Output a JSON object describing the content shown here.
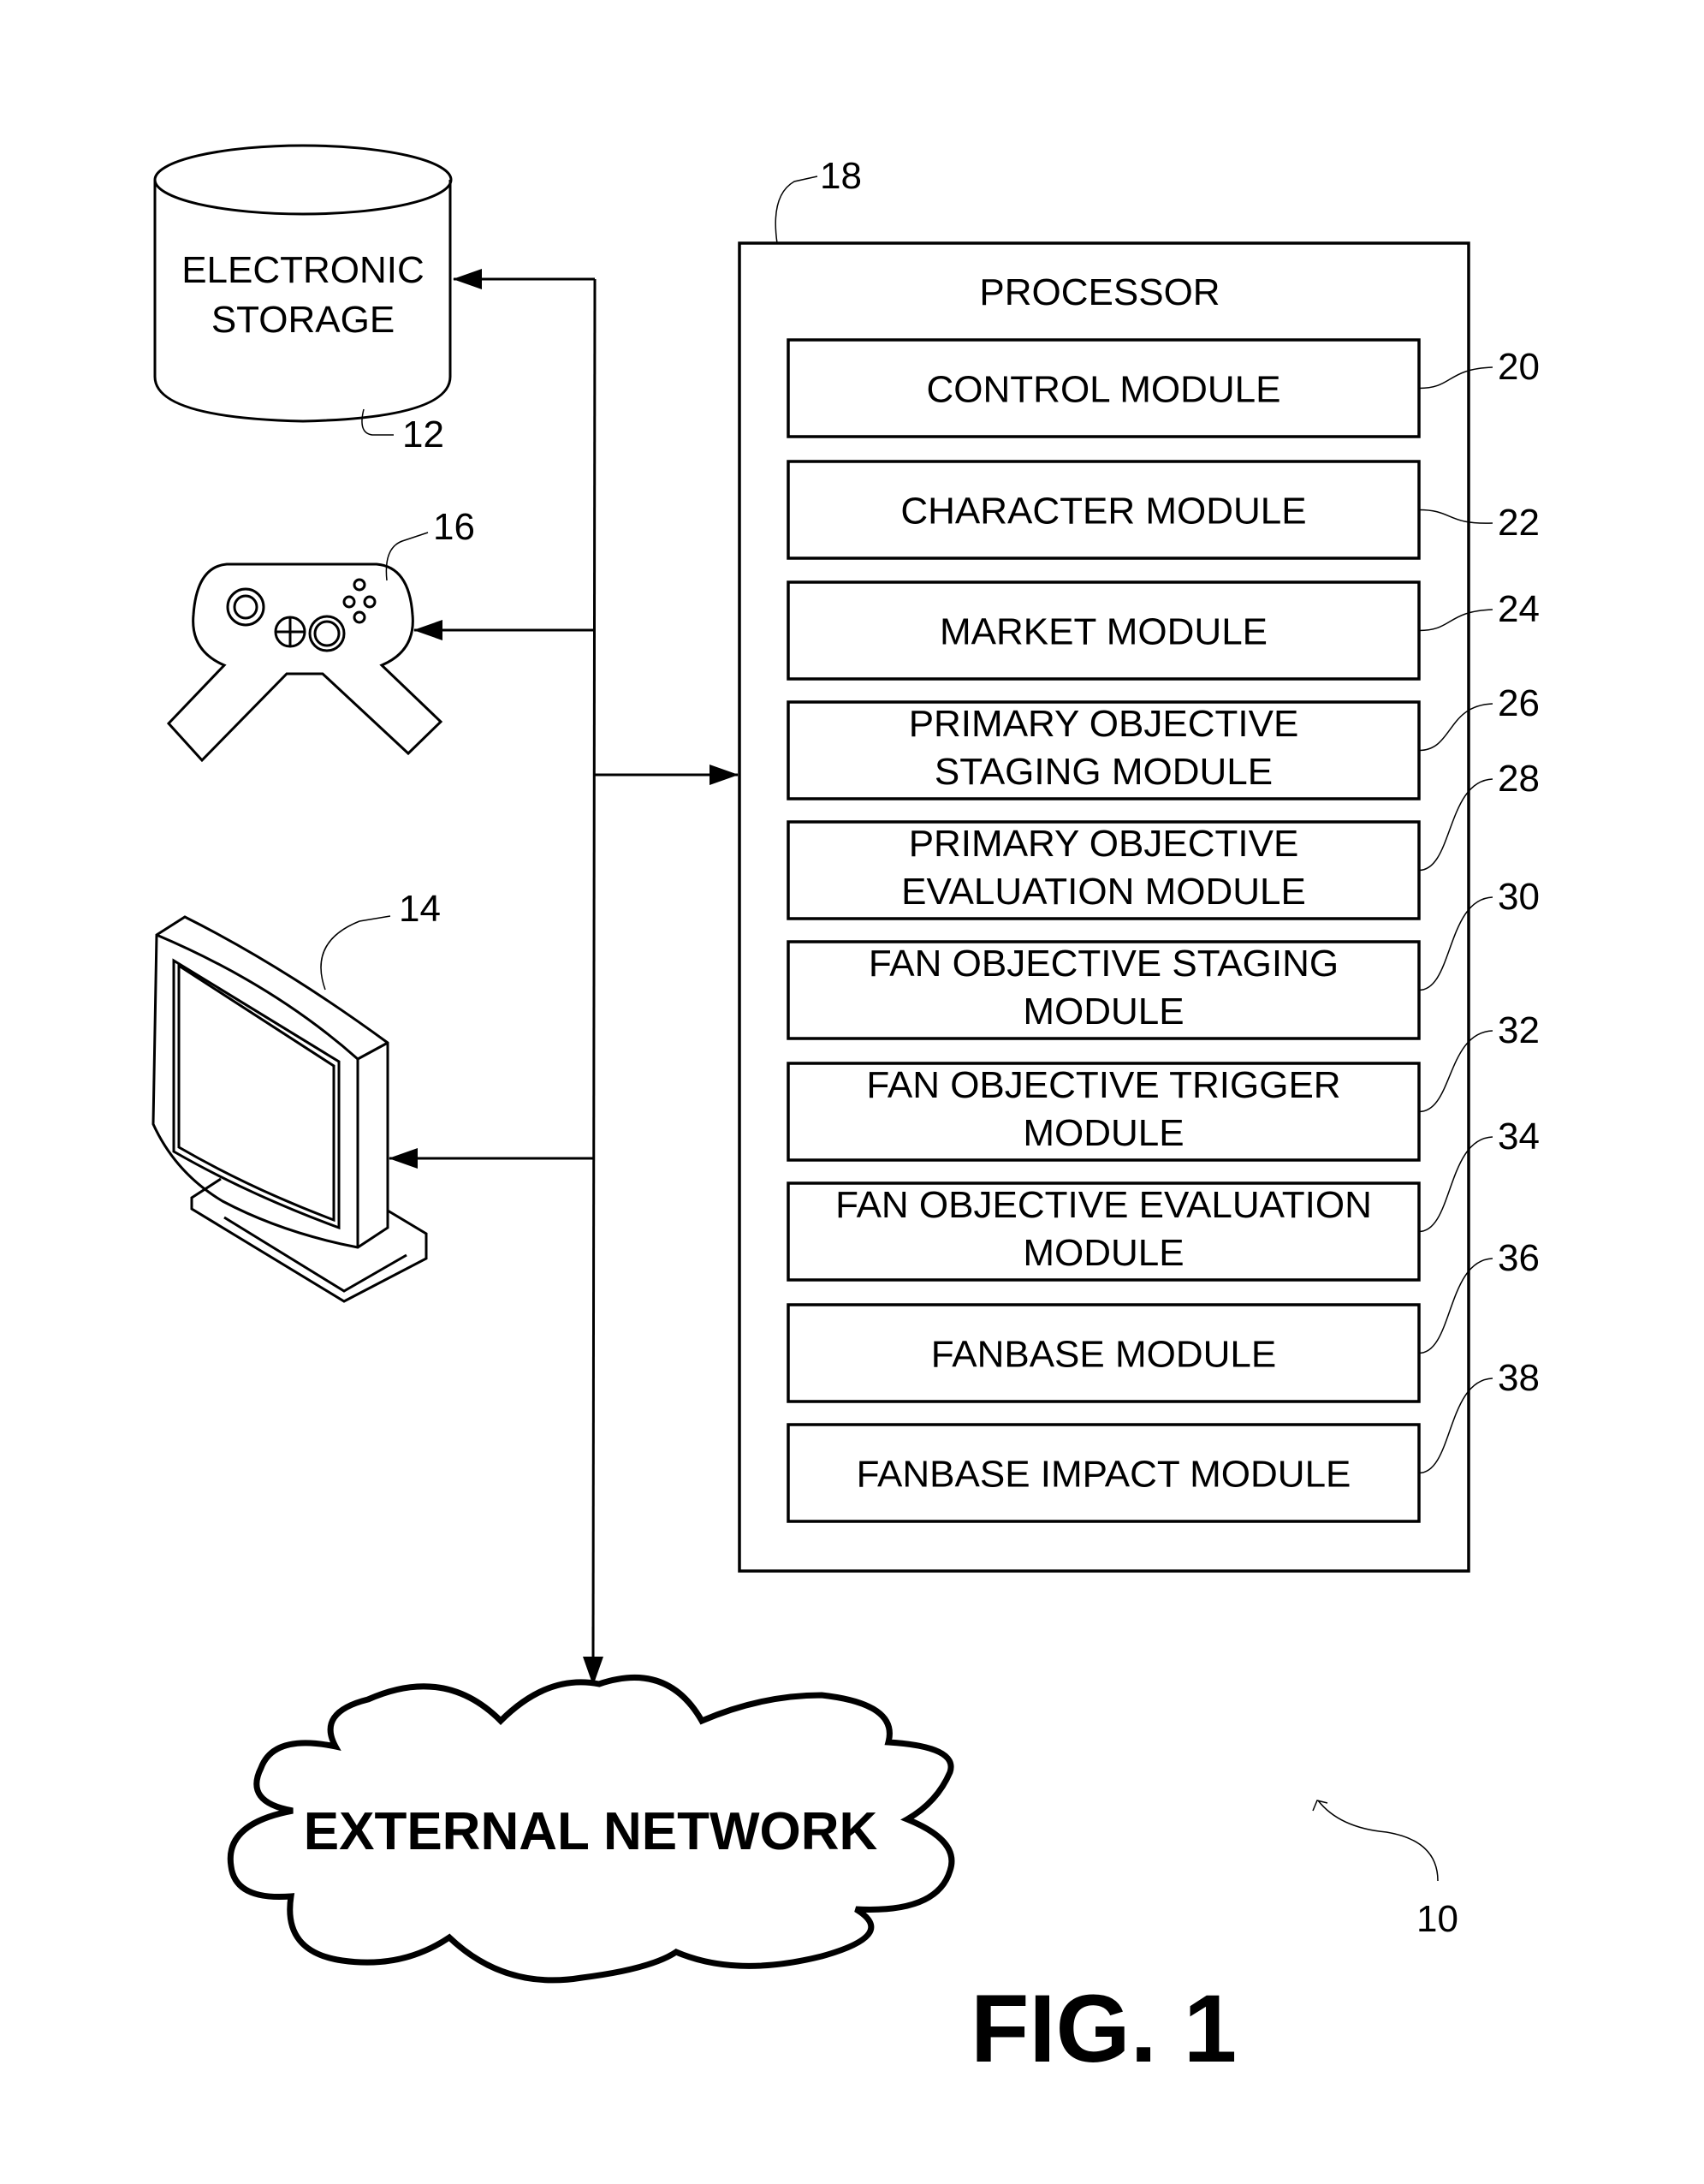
{
  "figure": {
    "title": "FIG. 1",
    "system_ref": "10"
  },
  "storage": {
    "label_lines": [
      "ELECTRONIC",
      "STORAGE"
    ],
    "ref": "12",
    "icon": "database-cylinder-icon"
  },
  "display": {
    "ref": "14",
    "icon": "monitor-icon"
  },
  "controller": {
    "ref": "16",
    "icon": "gamepad-icon"
  },
  "processor": {
    "title": "PROCESSOR",
    "ref": "18",
    "modules": [
      {
        "lines": [
          "CONTROL MODULE"
        ],
        "ref": "20"
      },
      {
        "lines": [
          "CHARACTER MODULE"
        ],
        "ref": "22"
      },
      {
        "lines": [
          "MARKET MODULE"
        ],
        "ref": "24"
      },
      {
        "lines": [
          "PRIMARY OBJECTIVE",
          "STAGING MODULE"
        ],
        "ref": "26"
      },
      {
        "lines": [
          "PRIMARY OBJECTIVE",
          "EVALUATION MODULE"
        ],
        "ref": "28"
      },
      {
        "lines": [
          "FAN OBJECTIVE STAGING",
          "MODULE"
        ],
        "ref": "30"
      },
      {
        "lines": [
          "FAN OBJECTIVE TRIGGER",
          "MODULE"
        ],
        "ref": "32"
      },
      {
        "lines": [
          "FAN OBJECTIVE EVALUATION",
          "MODULE"
        ],
        "ref": "34"
      },
      {
        "lines": [
          "FANBASE MODULE"
        ],
        "ref": "36"
      },
      {
        "lines": [
          "FANBASE IMPACT MODULE"
        ],
        "ref": "38"
      }
    ]
  },
  "network": {
    "label": "EXTERNAL NETWORK",
    "icon": "cloud-icon"
  }
}
